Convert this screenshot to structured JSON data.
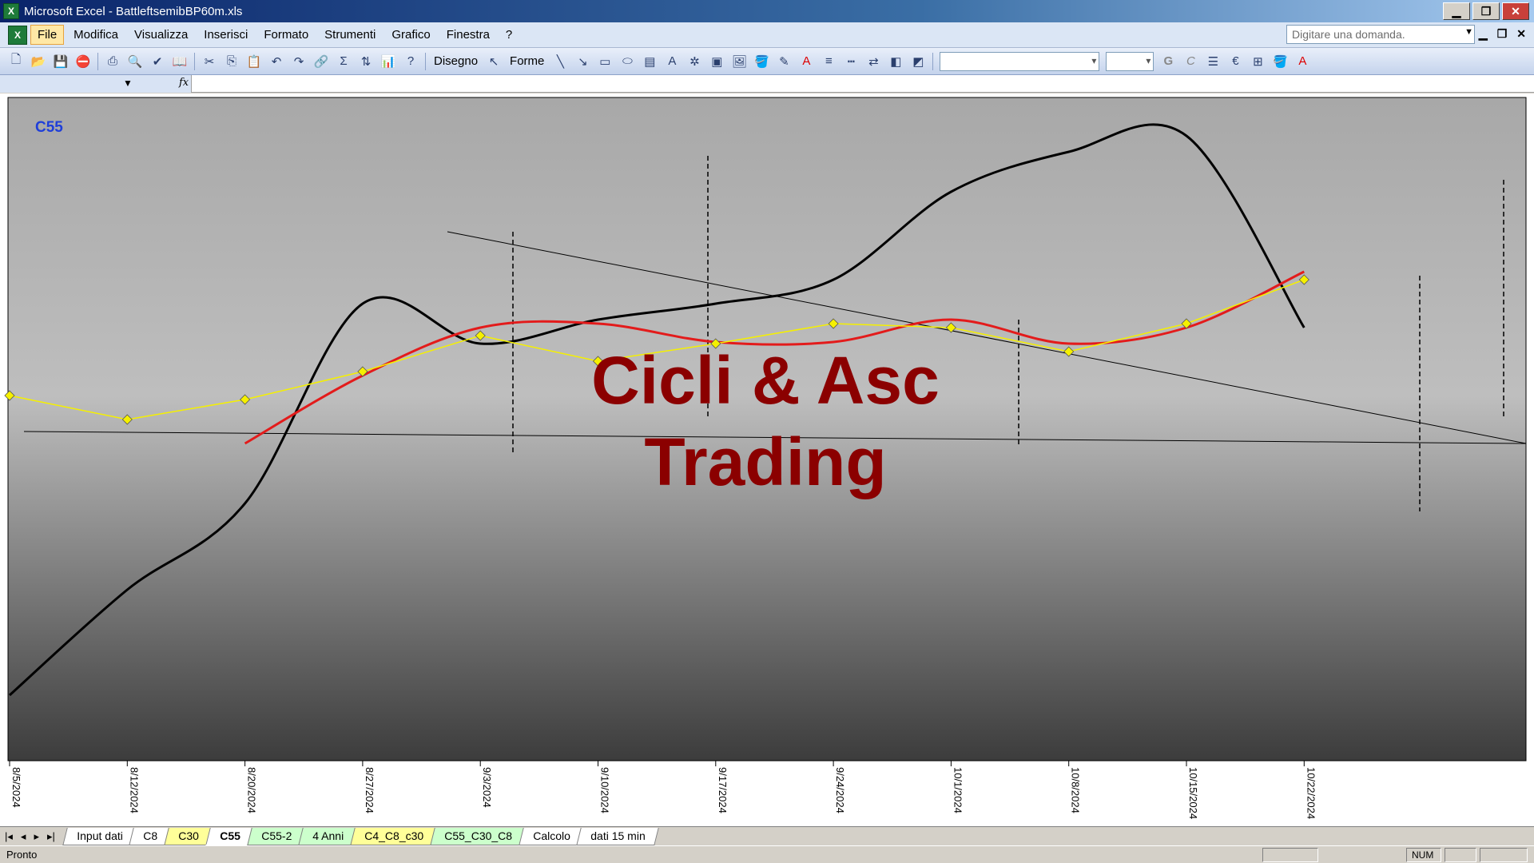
{
  "window": {
    "title": "Microsoft Excel - BattleftsemibBP60m.xls",
    "minimize": "▁",
    "maximize": "❐",
    "close": "✕"
  },
  "menubar": {
    "items": [
      "File",
      "Modifica",
      "Visualizza",
      "Inserisci",
      "Formato",
      "Strumenti",
      "Grafico",
      "Finestra",
      "?"
    ],
    "ask_placeholder": "Digitare una domanda."
  },
  "toolbar": {
    "drawing_label": "Disegno",
    "shapes_label": "Forme"
  },
  "chart": {
    "sheet_label": "C55",
    "watermark_line1": "Cicli & Asc",
    "watermark_line2": "Trading",
    "x_tick_labels": [
      "8/5/2024",
      "8/12/2024",
      "8/20/2024",
      "8/27/2024",
      "9/3/2024",
      "9/10/2024",
      "9/17/2024",
      "9/24/2024",
      "10/1/2024",
      "10/8/2024",
      "10/15/2024",
      "10/22/2024"
    ],
    "colors": {
      "price": "#f5f000",
      "moving_average": "#e31b1b",
      "oscillator": "#000000",
      "watermark": "#8b0000",
      "label": "#1f3fd9"
    }
  },
  "chart_data": {
    "type": "line",
    "title": "C55",
    "x": [
      "8/5/2024",
      "8/12/2024",
      "8/20/2024",
      "8/27/2024",
      "9/3/2024",
      "9/10/2024",
      "9/17/2024",
      "9/24/2024",
      "10/1/2024",
      "10/8/2024",
      "10/15/2024",
      "10/22/2024"
    ],
    "series": [
      {
        "name": "",
        "style": "yellow diamonds",
        "values": [
          495,
          525,
          500,
          465,
          420,
          452,
          430,
          405,
          410,
          440,
          405,
          350
        ]
      },
      {
        "name": "",
        "style": "red line",
        "values": [
          null,
          null,
          555,
          470,
          410,
          405,
          428,
          428,
          400,
          430,
          410,
          340
        ]
      },
      {
        "name": "",
        "style": "black line",
        "values": [
          870,
          738,
          630,
          380,
          430,
          400,
          380,
          350,
          240,
          190,
          170,
          410
        ]
      }
    ],
    "grid": false,
    "legend": "none"
  },
  "sheet_tabs": [
    {
      "label": "Input dati",
      "color": "#ffffff"
    },
    {
      "label": "C8",
      "color": "#ffffff"
    },
    {
      "label": "C30",
      "color": "#ffff99"
    },
    {
      "label": "C55",
      "color": "#ffffff"
    },
    {
      "label": "C55-2",
      "color": "#ccffcc"
    },
    {
      "label": "4 Anni",
      "color": "#ccffcc"
    },
    {
      "label": "C4_C8_c30",
      "color": "#ffff99"
    },
    {
      "label": "C55_C30_C8",
      "color": "#ccffcc"
    },
    {
      "label": "Calcolo",
      "color": "#ffffff"
    },
    {
      "label": "dati 15 min",
      "color": "#ffffff"
    }
  ],
  "active_tab": "C55",
  "status": {
    "text": "Pronto",
    "num": "NUM"
  }
}
